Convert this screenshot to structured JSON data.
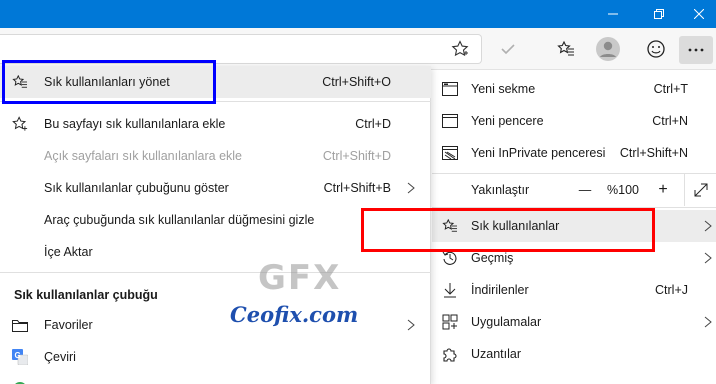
{
  "favorites_menu": {
    "items": [
      {
        "label": "Sık kullanılanları yönet",
        "shortcut": "Ctrl+Shift+O"
      },
      {
        "label": "Bu sayfayı sık kullanılanlara ekle",
        "shortcut": "Ctrl+D"
      },
      {
        "label": "Açık sayfaları sık kullanılanlara ekle",
        "shortcut": "Ctrl+Shift+D"
      },
      {
        "label": "Sık kullanılanlar çubuğunu göster",
        "shortcut": "Ctrl+Shift+B"
      },
      {
        "label": "Araç çubuğunda sık kullanılanlar düğmesini gizle",
        "shortcut": ""
      },
      {
        "label": "İçe Aktar",
        "shortcut": ""
      }
    ],
    "section_title": "Sık kullanılanlar çubuğu",
    "bar_items": [
      {
        "label": "Favoriler"
      },
      {
        "label": "Çeviri"
      }
    ]
  },
  "main_menu": {
    "items": [
      {
        "label": "Yeni sekme",
        "shortcut": "Ctrl+T"
      },
      {
        "label": "Yeni pencere",
        "shortcut": "Ctrl+N"
      },
      {
        "label": "Yeni InPrivate penceresi",
        "shortcut": "Ctrl+Shift+N"
      },
      {
        "label": "Yakınlaştır",
        "shortcut": ""
      },
      {
        "label": "Sık kullanılanlar",
        "shortcut": ""
      },
      {
        "label": "Geçmiş",
        "shortcut": ""
      },
      {
        "label": "İndirilenler",
        "shortcut": "Ctrl+J"
      },
      {
        "label": "Uygulamalar",
        "shortcut": ""
      },
      {
        "label": "Uzantılar",
        "shortcut": ""
      }
    ],
    "zoom": {
      "minus": "—",
      "value": "%100",
      "plus": "+"
    }
  },
  "watermark": {
    "logo": "GFX",
    "site": "Ceofix.com"
  },
  "colors": {
    "titlebar": "#0078d7",
    "highlight_blue": "#0000ff",
    "highlight_red": "#ff0000"
  }
}
